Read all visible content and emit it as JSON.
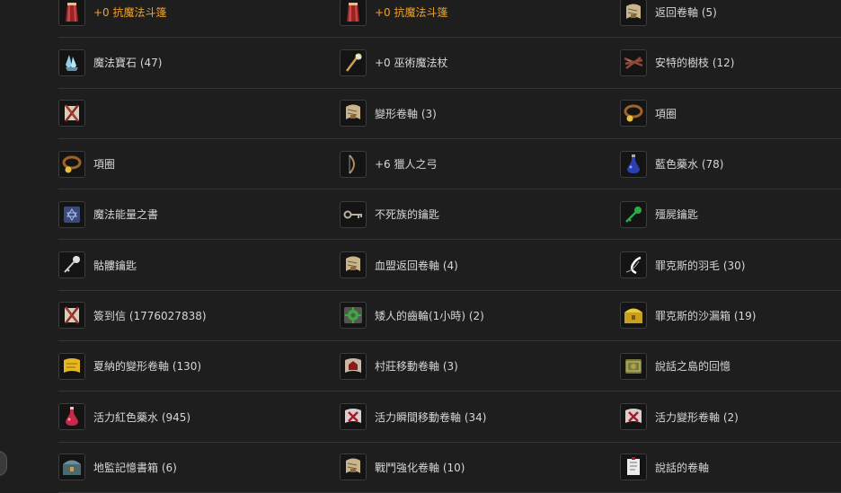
{
  "items": [
    {
      "label": "+0 抗魔法斗篷",
      "highlight": true,
      "icon": "cloak-icon"
    },
    {
      "label": "+0 抗魔法斗篷",
      "highlight": true,
      "icon": "cloak-icon"
    },
    {
      "label": "返回卷軸 (5)",
      "highlight": false,
      "icon": "scroll-icon"
    },
    {
      "label": "魔法寶石 (47)",
      "highlight": false,
      "icon": "crystal-icon"
    },
    {
      "label": "+0 巫術魔法杖",
      "highlight": false,
      "icon": "wand-icon"
    },
    {
      "label": "安特的樹枝 (12)",
      "highlight": false,
      "icon": "branch-icon"
    },
    {
      "label": "",
      "highlight": false,
      "icon": "letter-icon"
    },
    {
      "label": "變形卷軸 (3)",
      "highlight": false,
      "icon": "scroll-icon"
    },
    {
      "label": "項圈",
      "highlight": false,
      "icon": "collar-icon"
    },
    {
      "label": "項圈",
      "highlight": false,
      "icon": "collar-icon"
    },
    {
      "label": "+6 獵人之弓",
      "highlight": false,
      "icon": "bow-icon"
    },
    {
      "label": "藍色藥水 (78)",
      "highlight": false,
      "icon": "blue-potion-icon"
    },
    {
      "label": "魔法能量之書",
      "highlight": false,
      "icon": "spellbook-icon"
    },
    {
      "label": "不死族的鑰匙",
      "highlight": false,
      "icon": "key-icon"
    },
    {
      "label": "殭屍鑰匙",
      "highlight": false,
      "icon": "green-key-icon"
    },
    {
      "label": "骷髏鑰匙",
      "highlight": false,
      "icon": "skull-key-icon"
    },
    {
      "label": "血盟返回卷軸 (4)",
      "highlight": false,
      "icon": "scroll-icon"
    },
    {
      "label": "罪克斯的羽毛 (30)",
      "highlight": false,
      "icon": "feather-icon"
    },
    {
      "label": "簽到信 (1776027838)",
      "highlight": false,
      "icon": "letter-icon"
    },
    {
      "label": "矮人的齒輪(1小時) (2)",
      "highlight": false,
      "icon": "gear-icon"
    },
    {
      "label": "罪克斯的沙漏箱 (19)",
      "highlight": false,
      "icon": "gold-chest-icon"
    },
    {
      "label": "夏納的變形卷軸 (130)",
      "highlight": false,
      "icon": "gold-scroll-icon"
    },
    {
      "label": "村莊移動卷軸 (3)",
      "highlight": false,
      "icon": "village-scroll-icon"
    },
    {
      "label": "說話之島的回憶",
      "highlight": false,
      "icon": "memory-book-icon"
    },
    {
      "label": "活力紅色藥水 (945)",
      "highlight": false,
      "icon": "red-potion-icon"
    },
    {
      "label": "活力瞬間移動卷軸 (34)",
      "highlight": false,
      "icon": "red-scroll-icon"
    },
    {
      "label": "活力變形卷軸 (2)",
      "highlight": false,
      "icon": "red-scroll-icon"
    },
    {
      "label": "地監記憶書箱 (6)",
      "highlight": false,
      "icon": "chest-icon"
    },
    {
      "label": "戰鬥強化卷軸 (10)",
      "highlight": false,
      "icon": "scroll-icon"
    },
    {
      "label": "說話的卷軸",
      "highlight": false,
      "icon": "white-scroll-icon"
    }
  ],
  "colors": {
    "highlight": "#f0a229",
    "text": "#d6d6d6",
    "background": "#1e1e1e"
  }
}
